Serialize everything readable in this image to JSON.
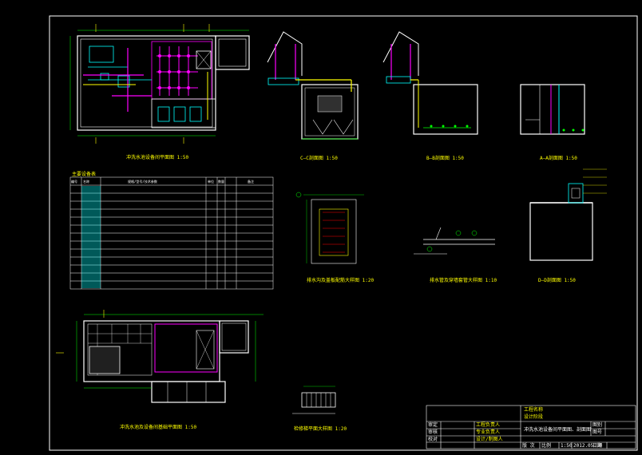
{
  "colors": {
    "background": "#000000",
    "frame": "#ffffff",
    "wall": "#ffffff",
    "pipe_primary": "#ff00ff",
    "pipe_secondary": "#00ffff",
    "annotation": "#ffff00",
    "dimension": "#00ff00",
    "hatch": "#808080",
    "water": "#00aaff"
  },
  "drawing_captions": {
    "plan_main": "冲洗水池设备间平面图 1:50",
    "section_cc": "C—C剖面图 1:50",
    "section_bb": "B—B剖面图 1:50",
    "section_aa": "A—A剖面图 1:50",
    "detail_1": "排水沟及盖板配筋大样图 1:20",
    "detail_2": "排水管及穿墙套管大样图 1:10",
    "section_dd": "D—D剖面图 1:50",
    "foundation_plan": "冲洗水池及设备间基础平面图 1:50",
    "detail_3": "检修梯平面大样图 1:20"
  },
  "equipment_table": {
    "title": "主要设备表",
    "headers": [
      "编号",
      "名称",
      "规格/型号/技术参数",
      "单位",
      "数量",
      "备注"
    ],
    "row_count": 13
  },
  "title_block": {
    "project_name_label": "工程名称",
    "design_stage_label": "设计阶段",
    "drawing_title": "冲洗水池设备间平面图、剖面图",
    "roles": [
      "审定",
      "审核",
      "校对"
    ],
    "people_roles": [
      "工程负责人",
      "专业负责人",
      "设计/制图人"
    ],
    "right_labels": [
      "图别",
      "图号",
      "日期"
    ],
    "scale_label": "比例",
    "scale_value": "1:50",
    "date_value": "2012.05.10",
    "sheet_label": "版 次"
  }
}
